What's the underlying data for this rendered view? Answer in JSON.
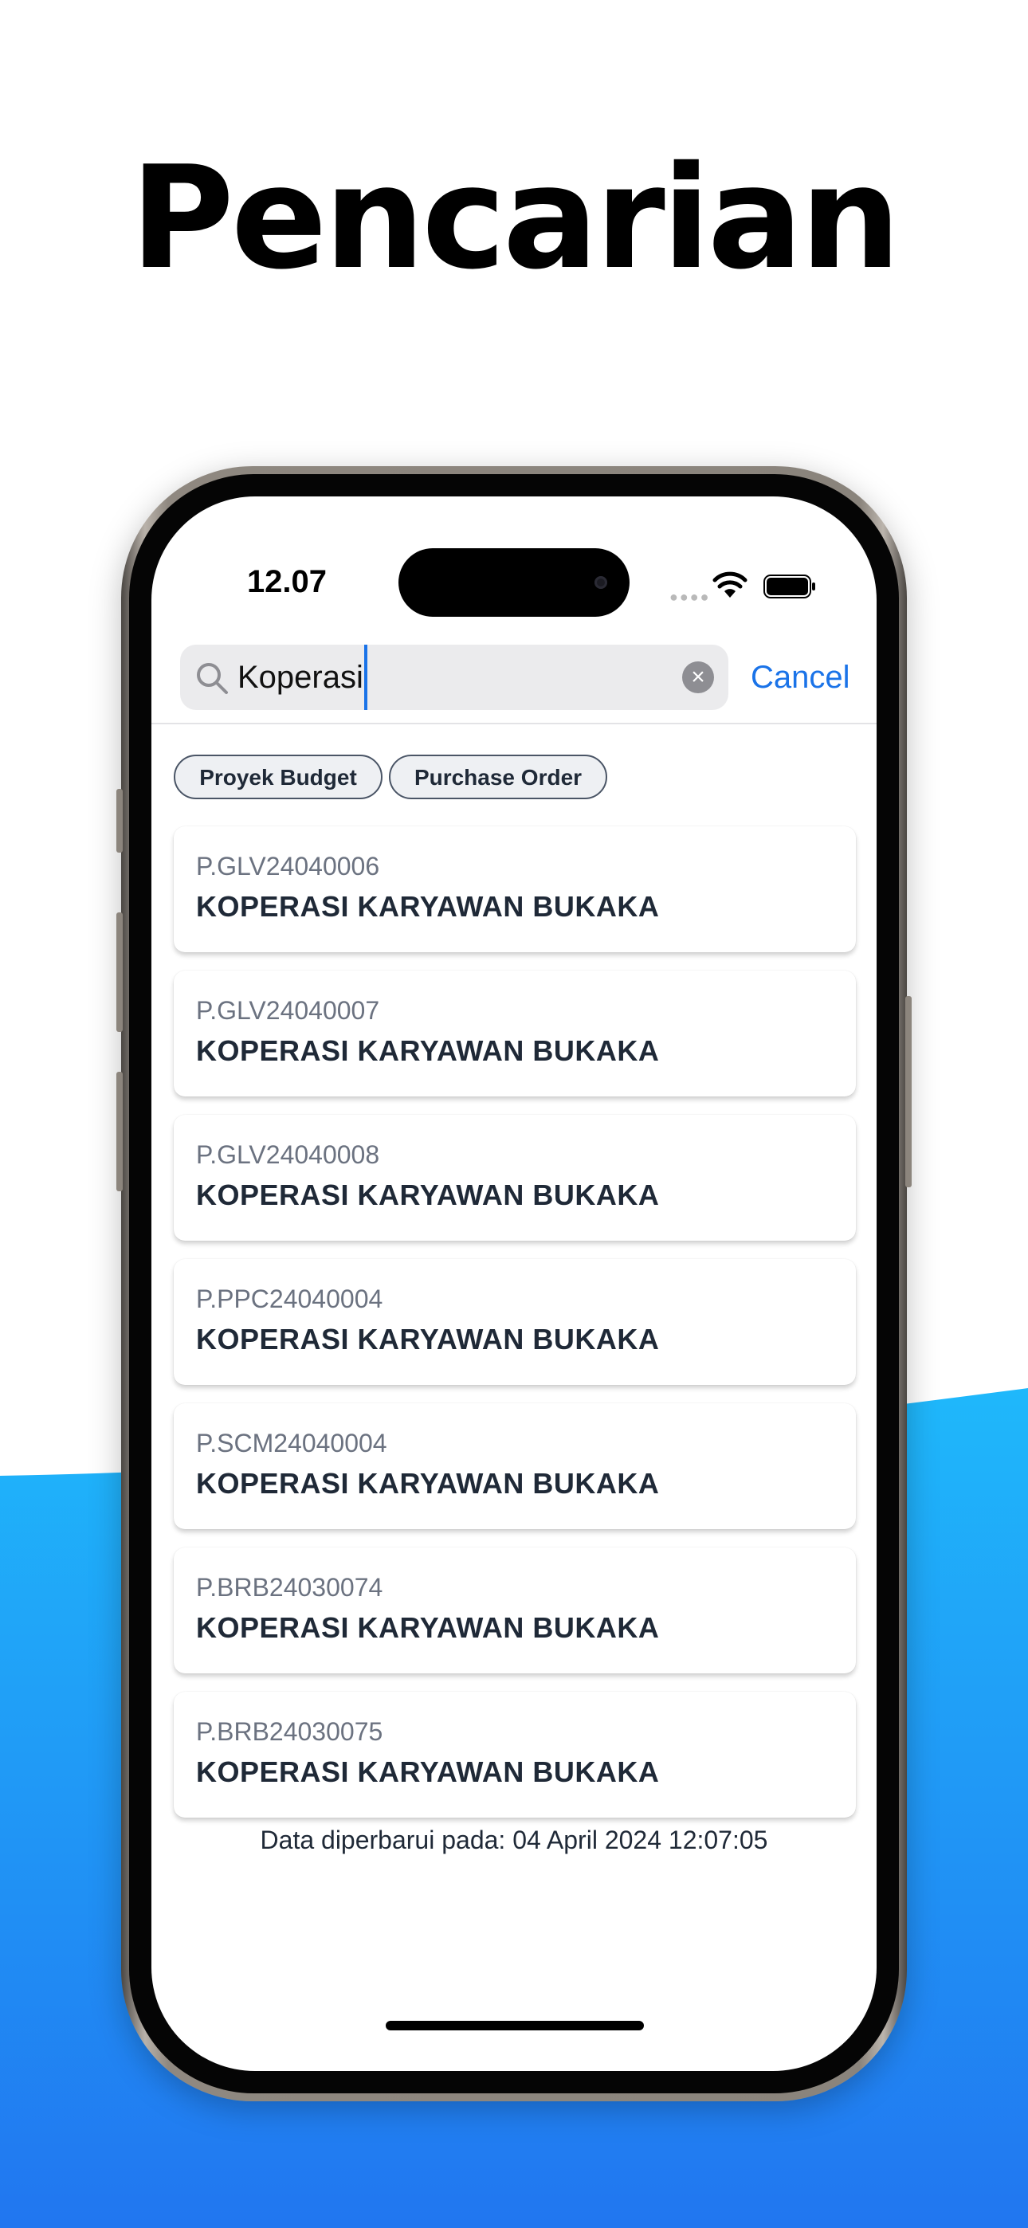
{
  "headline": "Pencarian",
  "status_bar": {
    "time": "12.07"
  },
  "search": {
    "query": "Koperasi",
    "cancel_label": "Cancel"
  },
  "filters": [
    "Proyek Budget",
    "Purchase Order"
  ],
  "results": [
    {
      "code": "P.GLV24040006",
      "name": "KOPERASI KARYAWAN BUKAKA"
    },
    {
      "code": "P.GLV24040007",
      "name": "KOPERASI KARYAWAN BUKAKA"
    },
    {
      "code": "P.GLV24040008",
      "name": "KOPERASI KARYAWAN BUKAKA"
    },
    {
      "code": "P.PPC24040004",
      "name": "KOPERASI KARYAWAN BUKAKA"
    },
    {
      "code": "P.SCM24040004",
      "name": "KOPERASI KARYAWAN BUKAKA"
    },
    {
      "code": "P.BRB24030074",
      "name": "KOPERASI KARYAWAN BUKAKA"
    },
    {
      "code": "P.BRB24030075",
      "name": "KOPERASI KARYAWAN BUKAKA"
    }
  ],
  "updated_text": "Data diperbarui pada: 04 April 2024 12:07:05",
  "colors": {
    "accent": "#1a73e8",
    "wave_top": "#1fb8fb",
    "wave_bottom": "#2176f0"
  },
  "icons": {
    "search": "magnifier-icon",
    "clear": "clear-x-icon",
    "wifi": "wifi-icon",
    "battery": "battery-icon"
  }
}
